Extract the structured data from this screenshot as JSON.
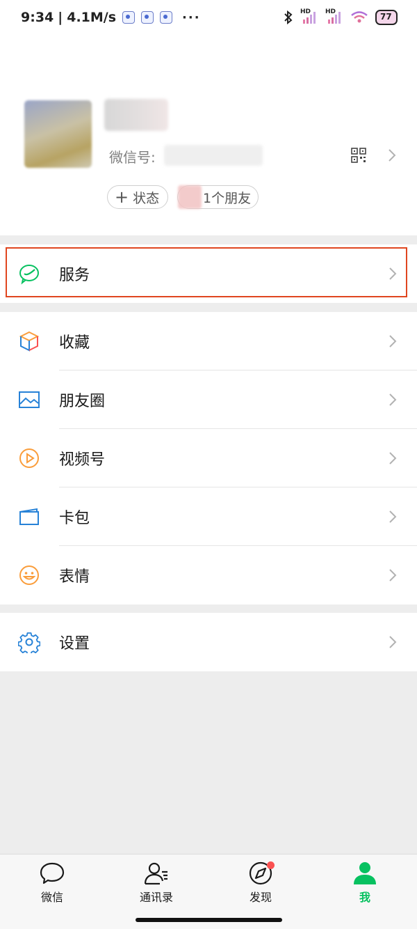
{
  "status_bar": {
    "time": "9:34",
    "separator": "|",
    "network_speed": "4.1M/s",
    "more": "···",
    "hd1": "HD",
    "hd2": "HD",
    "battery": "77"
  },
  "profile": {
    "wechat_id_label": "微信号:",
    "status_plus": "+",
    "status_label": "状态",
    "friends_label": "1个朋友"
  },
  "menu": {
    "services": "服务",
    "favorites": "收藏",
    "moments": "朋友圈",
    "channels": "视频号",
    "cards": "卡包",
    "stickers": "表情",
    "settings": "设置"
  },
  "colors": {
    "accent": "#07c160",
    "highlight": "#e0461f",
    "badge": "#fa5151"
  },
  "tabbar": {
    "chats": "微信",
    "contacts": "通讯录",
    "discover": "发现",
    "me": "我"
  }
}
